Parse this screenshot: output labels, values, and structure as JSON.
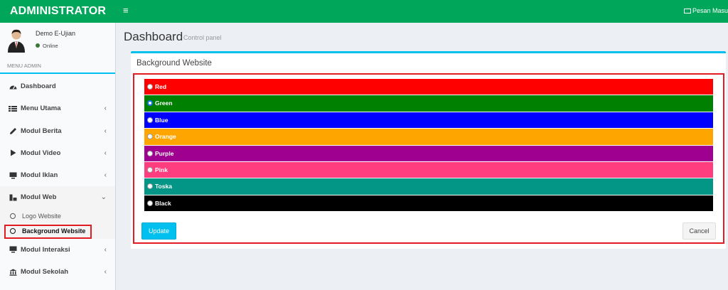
{
  "header": {
    "logo": "ADMINISTRATOR",
    "menu_toggle": "≡",
    "pesan": "Pesan Masu"
  },
  "user": {
    "name": "Demo E-Ujian",
    "status": "Online"
  },
  "sidebar": {
    "section_label": "MENU ADMIN",
    "items": [
      {
        "label": "Dashboard",
        "icon": "dashboard-icon",
        "chevron": ""
      },
      {
        "label": "Menu Utama",
        "icon": "list-icon",
        "chevron": "‹"
      },
      {
        "label": "Modul Berita",
        "icon": "pencil-icon",
        "chevron": "‹"
      },
      {
        "label": "Modul Video",
        "icon": "play-icon",
        "chevron": "‹"
      },
      {
        "label": "Modul Iklan",
        "icon": "monitor-icon",
        "chevron": "‹"
      },
      {
        "label": "Modul Web",
        "icon": "web-icon",
        "chevron": "⌄"
      },
      {
        "label": "Modul Interaksi",
        "icon": "monitor-icon",
        "chevron": "‹"
      },
      {
        "label": "Modul Sekolah",
        "icon": "institution-icon",
        "chevron": "‹"
      }
    ],
    "submenu": [
      {
        "label": "Logo Website"
      },
      {
        "label": "Background Website"
      }
    ]
  },
  "page": {
    "title": "Dashboard",
    "subtitle": "Control panel"
  },
  "box": {
    "title": "Background Website",
    "options": [
      {
        "label": "Red",
        "color": "#ff0000",
        "checked": false
      },
      {
        "label": "Green",
        "color": "#008000",
        "checked": true
      },
      {
        "label": "Blue",
        "color": "#0000ff",
        "checked": false
      },
      {
        "label": "Orange",
        "color": "#ffa500",
        "checked": false
      },
      {
        "label": "Purple",
        "color": "#a0008f",
        "checked": false
      },
      {
        "label": "Pink",
        "color": "#ff3d7f",
        "checked": false
      },
      {
        "label": "Toska",
        "color": "#039686",
        "checked": false
      },
      {
        "label": "Black",
        "color": "#000000",
        "checked": false
      }
    ],
    "update_label": "Update",
    "cancel_label": "Cancel"
  },
  "colors": {
    "header": "#00a65a",
    "accent": "#00c0ef",
    "highlight": "#e31b23"
  }
}
